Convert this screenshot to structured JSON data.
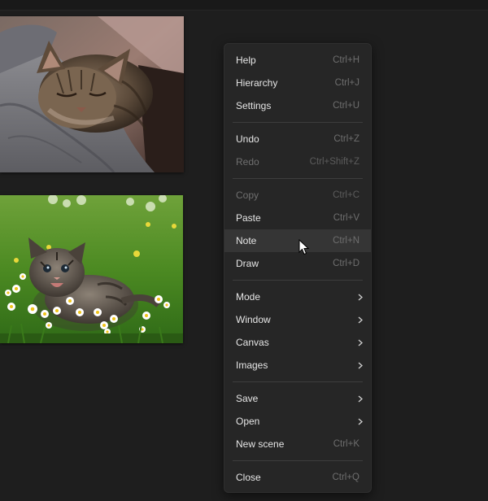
{
  "photos": {
    "top": {
      "subject": "sleeping tabby cat on grey blanket"
    },
    "bottom": {
      "subject": "tabby kitten in grass with daisies"
    }
  },
  "menu": {
    "groups": [
      [
        {
          "label": "Help",
          "shortcut": "Ctrl+H",
          "disabled": false
        },
        {
          "label": "Hierarchy",
          "shortcut": "Ctrl+J",
          "disabled": false
        },
        {
          "label": "Settings",
          "shortcut": "Ctrl+U",
          "disabled": false
        }
      ],
      [
        {
          "label": "Undo",
          "shortcut": "Ctrl+Z",
          "disabled": false
        },
        {
          "label": "Redo",
          "shortcut": "Ctrl+Shift+Z",
          "disabled": true
        }
      ],
      [
        {
          "label": "Copy",
          "shortcut": "Ctrl+C",
          "disabled": true
        },
        {
          "label": "Paste",
          "shortcut": "Ctrl+V",
          "disabled": false
        },
        {
          "label": "Note",
          "shortcut": "Ctrl+N",
          "disabled": false,
          "hovered": true
        },
        {
          "label": "Draw",
          "shortcut": "Ctrl+D",
          "disabled": false
        }
      ],
      [
        {
          "label": "Mode",
          "submenu": true
        },
        {
          "label": "Window",
          "submenu": true
        },
        {
          "label": "Canvas",
          "submenu": true
        },
        {
          "label": "Images",
          "submenu": true
        }
      ],
      [
        {
          "label": "Save",
          "submenu": true
        },
        {
          "label": "Open",
          "submenu": true
        },
        {
          "label": "New scene",
          "shortcut": "Ctrl+K",
          "disabled": false
        }
      ],
      [
        {
          "label": "Close",
          "shortcut": "Ctrl+Q",
          "disabled": false
        }
      ]
    ]
  },
  "icons": {
    "submenu": "chevron-right-icon",
    "cursor": "mouse-pointer-icon"
  },
  "colors": {
    "background": "#1e1e1e",
    "menu_bg": "#262626",
    "menu_hover": "#353535",
    "text": "#e6e6e6",
    "text_disabled": "#6f6f6f",
    "shortcut": "#6e6e6e",
    "separator": "#3d3d3d"
  }
}
